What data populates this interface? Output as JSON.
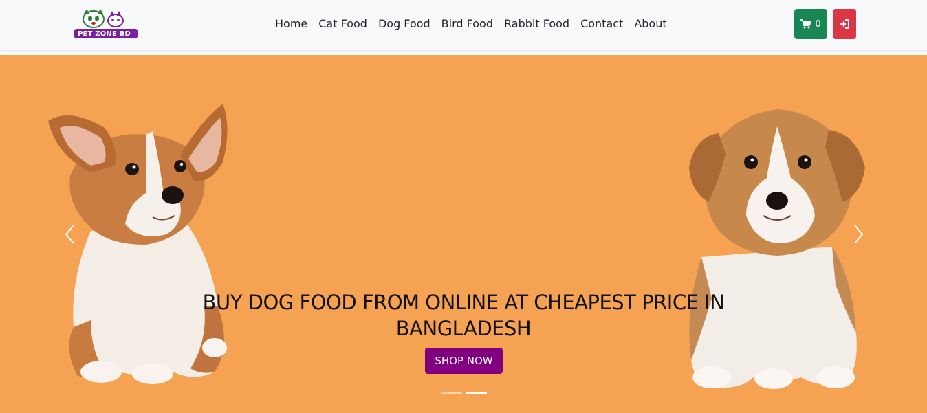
{
  "brand": {
    "logo_text": "PET ZONE BD"
  },
  "nav": {
    "links": [
      "Home",
      "Cat Food",
      "Dog Food",
      "Bird Food",
      "Rabbit Food",
      "Contact",
      "About"
    ]
  },
  "cart": {
    "count": "0",
    "icon": "cart-icon"
  },
  "login": {
    "icon": "sign-in-icon"
  },
  "hero": {
    "title": "BUY DOG FOOD FROM ONLINE AT CHEAPEST PRICE IN BANGLADESH",
    "cta": "SHOP NOW",
    "background_color": "#f5a352",
    "slides_count": 2,
    "active_slide": 2
  },
  "colors": {
    "cart_button": "#198754",
    "login_button": "#dc3545",
    "cta_button": "#800080"
  }
}
